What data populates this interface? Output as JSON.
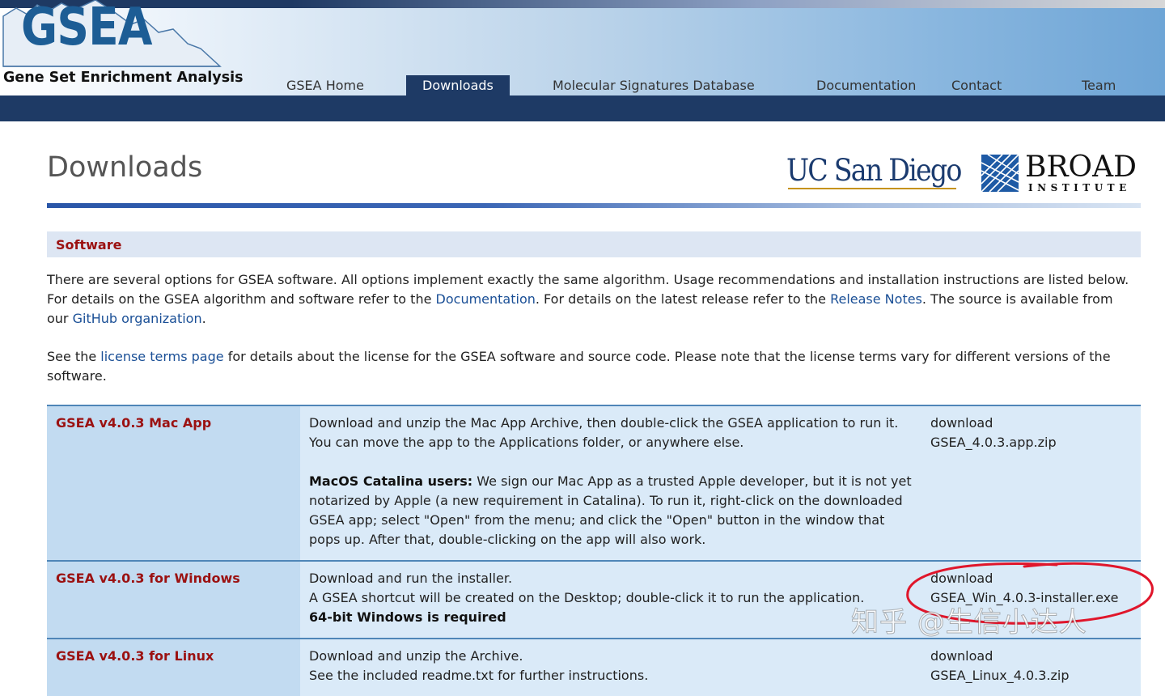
{
  "header": {
    "logo_text": "GSEA",
    "logo_subtitle": "Gene Set Enrichment Analysis",
    "nav": [
      {
        "label": "GSEA Home"
      },
      {
        "label": "Downloads",
        "active": true
      },
      {
        "label": "Molecular Signatures Database"
      },
      {
        "label": "Documentation"
      },
      {
        "label": "Contact"
      },
      {
        "label": "Team"
      }
    ]
  },
  "page": {
    "title": "Downloads",
    "logos": {
      "ucsd": "UC San Diego",
      "broad": "BROAD",
      "broad_sub": "INSTITUTE"
    }
  },
  "section": {
    "title": "Software",
    "para1": {
      "t1": "There are several options for GSEA software. All options implement exactly the same algorithm. Usage recommendations and installation instructions are listed below. For details on the GSEA algorithm and software refer to the ",
      "link1": "Documentation",
      "t2": ". For details on the latest release refer to the ",
      "link2": "Release Notes",
      "t3": ". The source is available from our ",
      "link3": "GitHub organization",
      "t4": "."
    },
    "para2": {
      "t1": "See the ",
      "link1": "license terms page",
      "t2": " for details about the license for the GSEA software and source code. Please note that the license terms vary for different versions of the software."
    }
  },
  "downloads": [
    {
      "name": "GSEA v4.0.3 Mac App",
      "desc1": "Download and unzip the Mac App Archive, then double-click the GSEA application to run it. You can move the app to the Applications folder, or anywhere else.",
      "desc_bold": "MacOS Catalina users:",
      "desc2": " We sign our Mac App as a trusted Apple developer, but it is not yet notarized by Apple (a new requirement in Catalina). To run it, right-click on the downloaded GSEA app; select \"Open\" from the menu; and click the \"Open\" button in the window that pops up. After that, double-clicking on the app will also work.",
      "link_label": "download",
      "file": "GSEA_4.0.3.app.zip"
    },
    {
      "name": "GSEA v4.0.3 for Windows",
      "line1": "Download and run the installer.",
      "line2": "A GSEA shortcut will be created on the Desktop; double-click it to run the application.",
      "line3_bold": "64-bit Windows is required",
      "link_label": "download",
      "file": "GSEA_Win_4.0.3-installer.exe"
    },
    {
      "name": "GSEA v4.0.3 for Linux",
      "line1": "Download and unzip the Archive.",
      "line2": "See the included readme.txt for further instructions.",
      "link_label": "download",
      "file": "GSEA_Linux_4.0.3.zip"
    }
  ],
  "watermark": "知乎 @生信小达人",
  "colors": {
    "nav_dark": "#1e3a65",
    "heading_red": "#9b1111",
    "link_blue": "#1a4f96",
    "row_name_bg": "#c2dbf1",
    "row_bg": "#daeaf8",
    "annotation_red": "#e0162b"
  }
}
